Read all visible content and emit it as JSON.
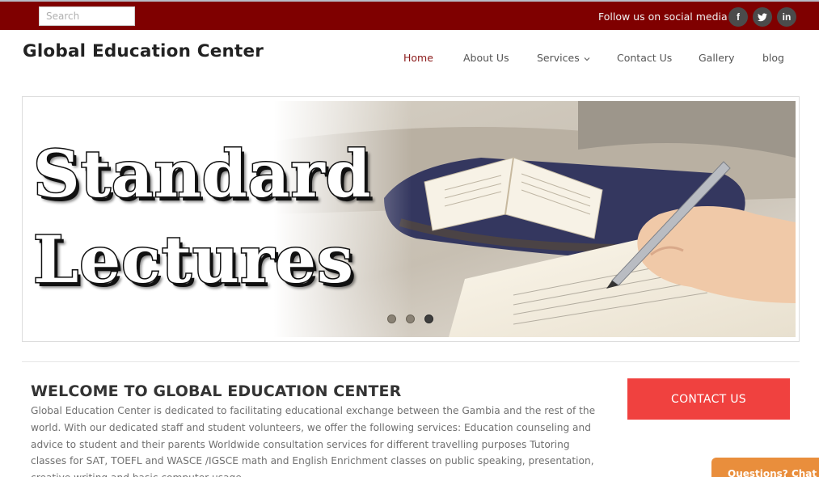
{
  "topbar": {
    "search_placeholder": "Search",
    "follow_text": "Follow us on social media",
    "social": [
      {
        "icon": "facebook-icon",
        "glyph": "f"
      },
      {
        "icon": "twitter-icon",
        "glyph": ""
      },
      {
        "icon": "linkedin-icon",
        "glyph": "in"
      }
    ],
    "background_color": "#7f0000"
  },
  "header": {
    "brand": "Global Education Center",
    "nav": [
      {
        "label": "Home",
        "active": true
      },
      {
        "label": "About Us",
        "active": false
      },
      {
        "label": "Services",
        "active": false,
        "has_dropdown": true
      },
      {
        "label": "Contact Us",
        "active": false
      },
      {
        "label": "Gallery",
        "active": false
      },
      {
        "label": "blog",
        "active": false
      }
    ]
  },
  "slider": {
    "line1": "Standard",
    "line2": "Lectures",
    "dots": 3,
    "active_dot": 3
  },
  "welcome": {
    "title": "WELCOME TO GLOBAL EDUCATION CENTER",
    "body": "Global Education Center is dedicated to facilitating educational exchange between the Gambia and the rest of the world. With our dedicated staff and student volunteers, we offer the following services: Education counseling and advice to student and their parents Worldwide consultation services for different travelling purposes Tutoring classes for SAT, TOEFL and WASCE /IGSCE math and English Enrichment classes on public speaking, presentation, creative writing and basic computer usage"
  },
  "cta": {
    "label": "CONTACT US",
    "color": "#f0413f"
  },
  "feedback_tab": {
    "label": "Questions? Chat"
  },
  "colors": {
    "accent": "#7f0000",
    "nav_active": "#8b1a1a",
    "feedback": "#e98e3c"
  }
}
